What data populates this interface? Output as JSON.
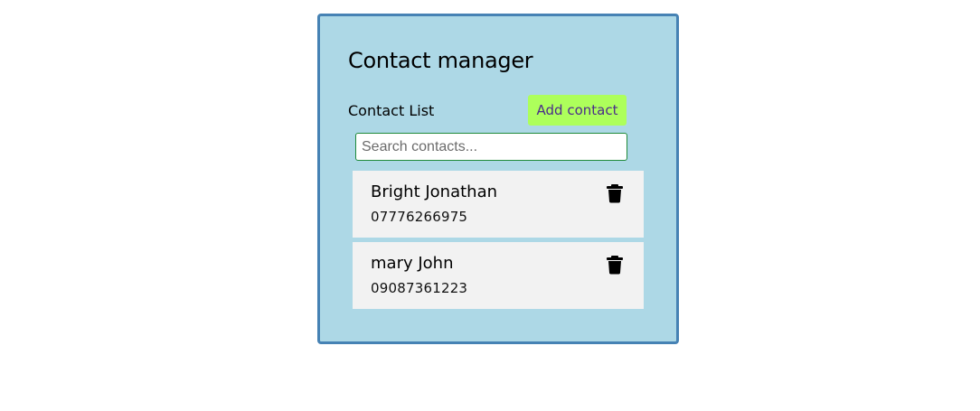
{
  "app": {
    "title": "Contact manager"
  },
  "list": {
    "label": "Contact List",
    "add_button_label": "Add contact"
  },
  "search": {
    "placeholder": "Search contacts...",
    "value": ""
  },
  "contacts": [
    {
      "name": "Bright Jonathan",
      "phone": "07776266975",
      "delete_icon": "trash-icon"
    },
    {
      "name": "mary John",
      "phone": "09087361223",
      "delete_icon": "trash-icon"
    }
  ],
  "colors": {
    "page_background": "#ffffff",
    "card_background": "#add8e6",
    "card_border": "#4682b4",
    "add_button_background": "#adff5b",
    "add_button_text": "#4b2c8a",
    "contact_background": "#f2f2f2",
    "search_border": "#1f8a3a"
  }
}
